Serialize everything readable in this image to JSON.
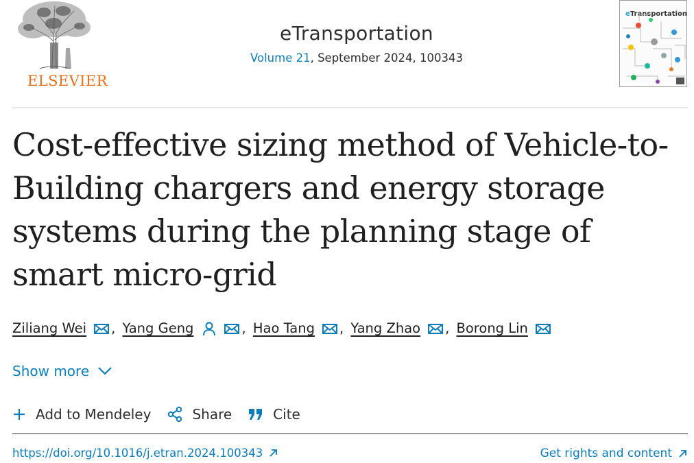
{
  "publisher": {
    "logo_text": "ELSEVIER",
    "logo_icon": "elsevier-tree-icon"
  },
  "journal": {
    "title": "eTransportation",
    "volume_link": "Volume 21",
    "issue_info": ", September 2024, 100343",
    "cover_title_e": "e",
    "cover_title_rest": "Transportation"
  },
  "article": {
    "title": "Cost-effective sizing method of Vehicle-to-Building chargers and energy storage systems during the planning stage of smart micro-grid"
  },
  "authors": [
    {
      "name": "Ziliang Wei",
      "icons": [
        "mail-icon"
      ]
    },
    {
      "name": "Yang Geng",
      "icons": [
        "person-icon",
        "mail-icon"
      ]
    },
    {
      "name": "Hao Tang",
      "icons": [
        "mail-icon"
      ]
    },
    {
      "name": "Yang Zhao",
      "icons": [
        "mail-icon"
      ]
    },
    {
      "name": "Borong Lin",
      "icons": [
        "mail-icon"
      ]
    }
  ],
  "author_separator": ",",
  "show_more": {
    "label": "Show more",
    "icon": "chevron-down-icon"
  },
  "actions": {
    "mendeley": {
      "label": "Add to Mendeley",
      "icon": "plus-icon"
    },
    "share": {
      "label": "Share",
      "icon": "share-icon"
    },
    "cite": {
      "label": "Cite",
      "icon": "quote-icon"
    }
  },
  "links": {
    "doi": "https://doi.org/10.1016/j.etran.2024.100343",
    "rights": "Get rights and content",
    "external_icon": "external-link-icon"
  },
  "colors": {
    "link": "#0c7dbb",
    "brand_orange": "#e9711c",
    "text": "#1f1f1f"
  }
}
